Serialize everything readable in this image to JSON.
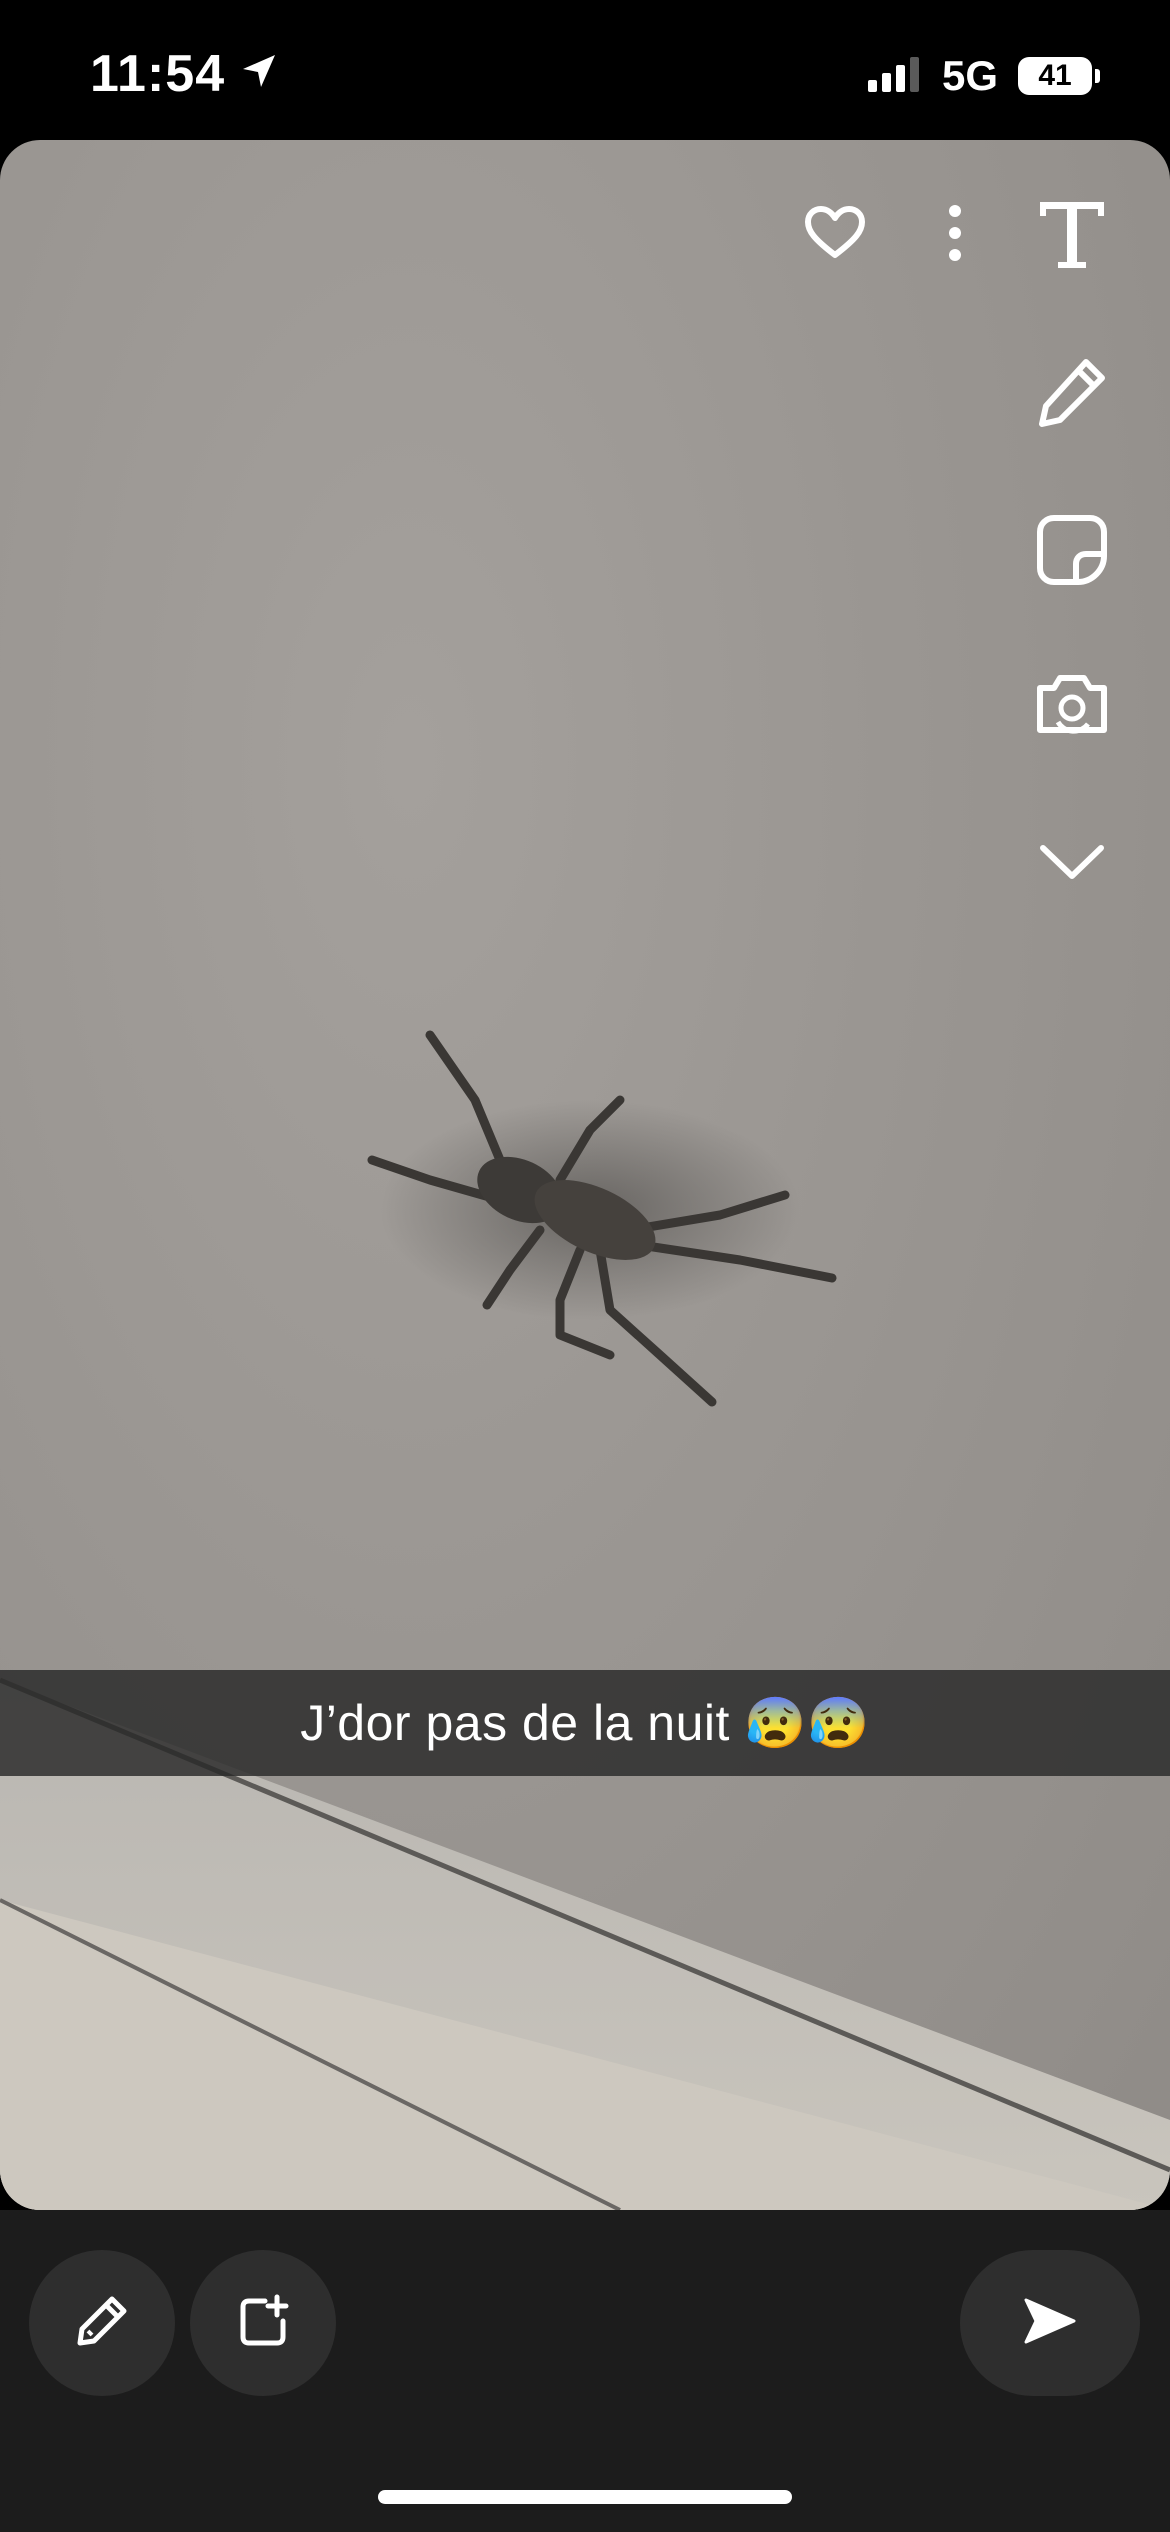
{
  "status_bar": {
    "time": "11:54",
    "network": "5G",
    "battery": "41",
    "location_icon": "location-arrow-icon",
    "signal_icon": "cellular-signal-icon"
  },
  "toolbar": {
    "icons": [
      "heart-icon",
      "more-vertical-icon",
      "text-tool-icon",
      "pencil-tool-icon",
      "sticker-icon",
      "camera-switch-icon",
      "chevron-down-icon"
    ]
  },
  "caption": {
    "text": "J’dor pas de la nuit 😰😰"
  },
  "bottom_bar": {
    "icons": [
      "edit-icon",
      "add-to-story-icon",
      "send-icon"
    ]
  },
  "colors": {
    "background": "#000000",
    "bottom_bar": "#1c1c1c",
    "button": "#2e2e2e",
    "photo_wall": "#9a9692",
    "caption_bg": "#282828"
  }
}
